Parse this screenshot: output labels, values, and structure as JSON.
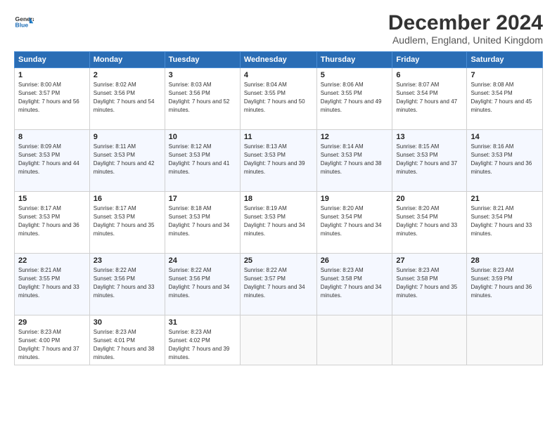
{
  "header": {
    "logo_line1": "General",
    "logo_line2": "Blue",
    "month": "December 2024",
    "location": "Audlem, England, United Kingdom"
  },
  "days_of_week": [
    "Sunday",
    "Monday",
    "Tuesday",
    "Wednesday",
    "Thursday",
    "Friday",
    "Saturday"
  ],
  "weeks": [
    [
      {
        "day": "1",
        "sunrise": "8:00 AM",
        "sunset": "3:57 PM",
        "daylight": "7 hours and 56 minutes."
      },
      {
        "day": "2",
        "sunrise": "8:02 AM",
        "sunset": "3:56 PM",
        "daylight": "7 hours and 54 minutes."
      },
      {
        "day": "3",
        "sunrise": "8:03 AM",
        "sunset": "3:56 PM",
        "daylight": "7 hours and 52 minutes."
      },
      {
        "day": "4",
        "sunrise": "8:04 AM",
        "sunset": "3:55 PM",
        "daylight": "7 hours and 50 minutes."
      },
      {
        "day": "5",
        "sunrise": "8:06 AM",
        "sunset": "3:55 PM",
        "daylight": "7 hours and 49 minutes."
      },
      {
        "day": "6",
        "sunrise": "8:07 AM",
        "sunset": "3:54 PM",
        "daylight": "7 hours and 47 minutes."
      },
      {
        "day": "7",
        "sunrise": "8:08 AM",
        "sunset": "3:54 PM",
        "daylight": "7 hours and 45 minutes."
      }
    ],
    [
      {
        "day": "8",
        "sunrise": "8:09 AM",
        "sunset": "3:53 PM",
        "daylight": "7 hours and 44 minutes."
      },
      {
        "day": "9",
        "sunrise": "8:11 AM",
        "sunset": "3:53 PM",
        "daylight": "7 hours and 42 minutes."
      },
      {
        "day": "10",
        "sunrise": "8:12 AM",
        "sunset": "3:53 PM",
        "daylight": "7 hours and 41 minutes."
      },
      {
        "day": "11",
        "sunrise": "8:13 AM",
        "sunset": "3:53 PM",
        "daylight": "7 hours and 39 minutes."
      },
      {
        "day": "12",
        "sunrise": "8:14 AM",
        "sunset": "3:53 PM",
        "daylight": "7 hours and 38 minutes."
      },
      {
        "day": "13",
        "sunrise": "8:15 AM",
        "sunset": "3:53 PM",
        "daylight": "7 hours and 37 minutes."
      },
      {
        "day": "14",
        "sunrise": "8:16 AM",
        "sunset": "3:53 PM",
        "daylight": "7 hours and 36 minutes."
      }
    ],
    [
      {
        "day": "15",
        "sunrise": "8:17 AM",
        "sunset": "3:53 PM",
        "daylight": "7 hours and 36 minutes."
      },
      {
        "day": "16",
        "sunrise": "8:17 AM",
        "sunset": "3:53 PM",
        "daylight": "7 hours and 35 minutes."
      },
      {
        "day": "17",
        "sunrise": "8:18 AM",
        "sunset": "3:53 PM",
        "daylight": "7 hours and 34 minutes."
      },
      {
        "day": "18",
        "sunrise": "8:19 AM",
        "sunset": "3:53 PM",
        "daylight": "7 hours and 34 minutes."
      },
      {
        "day": "19",
        "sunrise": "8:20 AM",
        "sunset": "3:54 PM",
        "daylight": "7 hours and 34 minutes."
      },
      {
        "day": "20",
        "sunrise": "8:20 AM",
        "sunset": "3:54 PM",
        "daylight": "7 hours and 33 minutes."
      },
      {
        "day": "21",
        "sunrise": "8:21 AM",
        "sunset": "3:54 PM",
        "daylight": "7 hours and 33 minutes."
      }
    ],
    [
      {
        "day": "22",
        "sunrise": "8:21 AM",
        "sunset": "3:55 PM",
        "daylight": "7 hours and 33 minutes."
      },
      {
        "day": "23",
        "sunrise": "8:22 AM",
        "sunset": "3:56 PM",
        "daylight": "7 hours and 33 minutes."
      },
      {
        "day": "24",
        "sunrise": "8:22 AM",
        "sunset": "3:56 PM",
        "daylight": "7 hours and 34 minutes."
      },
      {
        "day": "25",
        "sunrise": "8:22 AM",
        "sunset": "3:57 PM",
        "daylight": "7 hours and 34 minutes."
      },
      {
        "day": "26",
        "sunrise": "8:23 AM",
        "sunset": "3:58 PM",
        "daylight": "7 hours and 34 minutes."
      },
      {
        "day": "27",
        "sunrise": "8:23 AM",
        "sunset": "3:58 PM",
        "daylight": "7 hours and 35 minutes."
      },
      {
        "day": "28",
        "sunrise": "8:23 AM",
        "sunset": "3:59 PM",
        "daylight": "7 hours and 36 minutes."
      }
    ],
    [
      {
        "day": "29",
        "sunrise": "8:23 AM",
        "sunset": "4:00 PM",
        "daylight": "7 hours and 37 minutes."
      },
      {
        "day": "30",
        "sunrise": "8:23 AM",
        "sunset": "4:01 PM",
        "daylight": "7 hours and 38 minutes."
      },
      {
        "day": "31",
        "sunrise": "8:23 AM",
        "sunset": "4:02 PM",
        "daylight": "7 hours and 39 minutes."
      },
      null,
      null,
      null,
      null
    ]
  ]
}
